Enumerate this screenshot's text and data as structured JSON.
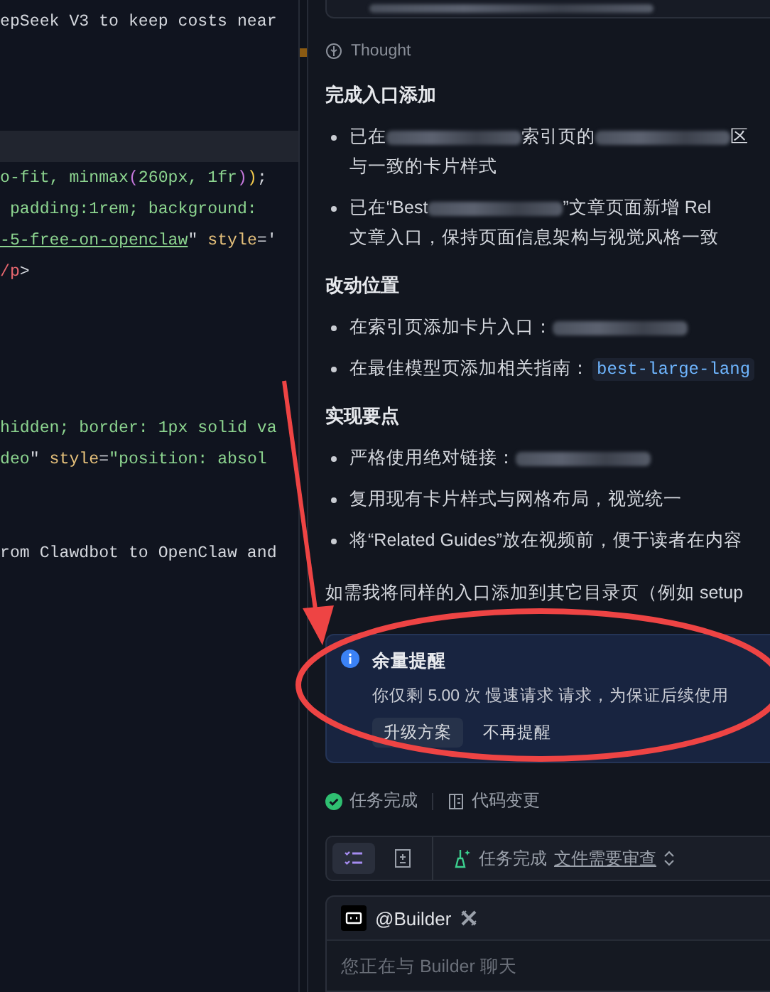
{
  "editor": {
    "lines": [
      {
        "kind": "code",
        "tokens": [
          {
            "kind": "plain",
            "text": "epSeek V3 to keep costs near"
          }
        ]
      },
      {
        "kind": "marked"
      },
      {
        "kind": "blank"
      },
      {
        "kind": "blank"
      },
      {
        "kind": "current"
      },
      {
        "kind": "code",
        "tokens": [
          {
            "kind": "str",
            "text": "o-fit, minmax"
          },
          {
            "kind": "paren1",
            "text": "("
          },
          {
            "kind": "str",
            "text": "260px, 1fr"
          },
          {
            "kind": "paren1",
            "text": ")"
          },
          {
            "kind": "paren2",
            "text": ")"
          },
          {
            "kind": "plain",
            "text": ";"
          }
        ]
      },
      {
        "kind": "code",
        "tokens": [
          {
            "kind": "str",
            "text": " padding:1rem; background: "
          }
        ]
      },
      {
        "kind": "code",
        "tokens": [
          {
            "kind": "link",
            "text": "-5-free-on-openclaw"
          },
          {
            "kind": "plain",
            "text": "\" "
          },
          {
            "kind": "attr",
            "text": "style"
          },
          {
            "kind": "plain",
            "text": "='"
          }
        ]
      },
      {
        "kind": "code",
        "tokens": [
          {
            "kind": "tag",
            "text": "/p"
          },
          {
            "kind": "plain",
            "text": ">"
          }
        ]
      },
      {
        "kind": "blank"
      },
      {
        "kind": "blank"
      },
      {
        "kind": "blank"
      },
      {
        "kind": "blank"
      },
      {
        "kind": "code",
        "tokens": [
          {
            "kind": "str",
            "text": "hidden; border: 1px solid va"
          }
        ]
      },
      {
        "kind": "code",
        "tokens": [
          {
            "kind": "str",
            "text": "deo"
          },
          {
            "kind": "plain",
            "text": "\" "
          },
          {
            "kind": "attr",
            "text": "style"
          },
          {
            "kind": "plain",
            "text": "="
          },
          {
            "kind": "str",
            "text": "\"position: absol"
          }
        ]
      },
      {
        "kind": "blank"
      },
      {
        "kind": "blank"
      },
      {
        "kind": "code",
        "tokens": [
          {
            "kind": "plain",
            "text": "rom Clawdbot to OpenClaw and"
          }
        ]
      }
    ]
  },
  "chat": {
    "thought_label": "Thought",
    "sections": [
      {
        "heading": "完成入口添加",
        "bullets": [
          {
            "lines": [
              [
                {
                  "kind": "text",
                  "text": "已在"
                },
                {
                  "kind": "redacted"
                },
                {
                  "kind": "text",
                  "text": "索引页的"
                },
                {
                  "kind": "redacted"
                },
                {
                  "kind": "text",
                  "text": "区"
                }
              ],
              [
                {
                  "kind": "text",
                  "text": "与一致的卡片样式"
                }
              ]
            ]
          },
          {
            "lines": [
              [
                {
                  "kind": "text",
                  "text": "已在“Best"
                },
                {
                  "kind": "redacted"
                },
                {
                  "kind": "text",
                  "text": "”文章页面新增 Rel"
                }
              ],
              [
                {
                  "kind": "text",
                  "text": "文章入口，保持页面信息架构与视觉风格一致"
                }
              ]
            ]
          }
        ]
      },
      {
        "heading": "改动位置",
        "bullets": [
          {
            "lines": [
              [
                {
                  "kind": "text",
                  "text": "在索引页添加卡片入口："
                },
                {
                  "kind": "redacted"
                }
              ]
            ]
          },
          {
            "lines": [
              [
                {
                  "kind": "text",
                  "text": "在最佳模型页添加相关指南："
                },
                {
                  "kind": "code",
                  "text": "best-large-lang"
                }
              ]
            ]
          }
        ]
      },
      {
        "heading": "实现要点",
        "bullets": [
          {
            "lines": [
              [
                {
                  "kind": "text",
                  "text": "严格使用绝对链接："
                },
                {
                  "kind": "redacted"
                }
              ]
            ]
          },
          {
            "lines": [
              [
                {
                  "kind": "text",
                  "text": "复用现有卡片样式与网格布局，视觉统一"
                }
              ]
            ]
          },
          {
            "lines": [
              [
                {
                  "kind": "text",
                  "text": "将“Related Guides”放在视频前，便于读者在内容"
                }
              ]
            ]
          }
        ]
      }
    ],
    "closing": "如需我将同样的入口添加到其它目录页（例如 setup",
    "notice": {
      "title": "余量提醒",
      "message": "你仅剩 5.00 次 慢速请求 请求，为保证后续使用",
      "actions": [
        {
          "label": "升级方案",
          "kind": "primary"
        },
        {
          "label": "不再提醒",
          "kind": "plain"
        }
      ]
    },
    "status": [
      {
        "label": "任务完成",
        "kind": "done"
      },
      {
        "label": "代码变更",
        "kind": "diff"
      }
    ],
    "toolbar": {
      "tabs": [
        {
          "kind": "tasks",
          "selected": true
        },
        {
          "kind": "files",
          "selected": false
        }
      ],
      "status": "任务完成",
      "link": "文件需要审查"
    },
    "composer": {
      "agent": "@Builder",
      "placeholder": "您正在与 Builder 聊天"
    }
  }
}
